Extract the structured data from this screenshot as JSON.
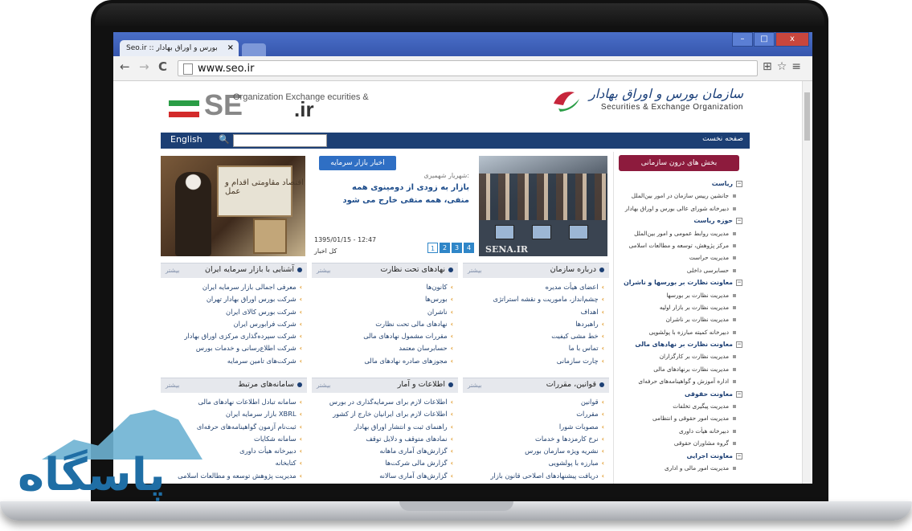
{
  "browser": {
    "tab_title": "Seo.ir :: بورس و اوراق بهادار",
    "tab_close": "×",
    "url": "www.seo.ir",
    "nav_back": "←",
    "nav_forward": "→",
    "nav_reload": "C",
    "toolbar_icons": "⊞☆≡",
    "win_min": "–",
    "win_max": "□",
    "win_close": "x"
  },
  "site": {
    "seo_logo": {
      "letters": "SE",
      "small": "Organization Exchange ecurities &",
      "ir": ".ir"
    },
    "org_logo": {
      "fa": "سازمان بورس و اوراق بهادار",
      "en_html": "Securities & Exchange Organization"
    },
    "nav": {
      "english": "English",
      "search_icon": "🔍",
      "home": "صفحه نخست"
    },
    "slide_left": {
      "calligraphy": "اقتصاد مقاومتی اقدام و عمل"
    },
    "news": {
      "button": "اخبار بازار سرمایه",
      "source": "شهریار شهمیری:",
      "title": "بازار به زودی از دومینوی همه منفی، همه منفی خارج می شود",
      "date": "1395/01/15 - 12:47",
      "all_news": "کل اخبار",
      "pages": [
        "1",
        "2",
        "3",
        "4"
      ]
    },
    "slide_right": {
      "watermark": "SENA.IR"
    },
    "sidebar": {
      "header": "بخش های درون سازمانی",
      "items": [
        {
          "t": "ریاست",
          "k": "h"
        },
        {
          "t": "جانشین رییس سازمان در امور بین‌الملل",
          "k": "s"
        },
        {
          "t": "دبیرخانه شورای عالی بورس و اوراق بهادار",
          "k": "s"
        },
        {
          "t": "حوزه ریاست",
          "k": "h"
        },
        {
          "t": "مدیریت روابط عمومی و امور بین‌الملل",
          "k": "s"
        },
        {
          "t": "مرکز پژوهش، توسعه و مطالعات اسلامی",
          "k": "s"
        },
        {
          "t": "مدیریت حراست",
          "k": "s"
        },
        {
          "t": "حسابرسی داخلی",
          "k": "s"
        },
        {
          "t": "معاونت نظارت بر بورسها و ناشران",
          "k": "h"
        },
        {
          "t": "مدیریت نظارت بر بورسها",
          "k": "s"
        },
        {
          "t": "مدیریت نظارت بر بازار اولیه",
          "k": "s"
        },
        {
          "t": "مدیریت نظارت بر ناشران",
          "k": "s"
        },
        {
          "t": "دبیرخانه کمیته مبارزه با پولشویی",
          "k": "s"
        },
        {
          "t": "معاونت نظارت بر نهادهای مالی",
          "k": "h"
        },
        {
          "t": "مدیریت نظارت بر کارگزاران",
          "k": "s"
        },
        {
          "t": "مدیریت نظارت برنهادهای مالی",
          "k": "s"
        },
        {
          "t": "اداره آموزش و گواهینامه‌های حرفه‌ای",
          "k": "s"
        },
        {
          "t": "معاونت حقوقی",
          "k": "h"
        },
        {
          "t": "مدیریت پیگیری تخلفات",
          "k": "s"
        },
        {
          "t": "مدیریت امور حقوقی و انتظامی",
          "k": "s"
        },
        {
          "t": "دبیرخانه هیأت داوری",
          "k": "s"
        },
        {
          "t": "گروه مشاوران حقوقی",
          "k": "s"
        },
        {
          "t": "معاونت اجرایی",
          "k": "h"
        },
        {
          "t": "مدیریت امور مالی و اداری",
          "k": "s"
        }
      ]
    },
    "boxes": [
      {
        "title": "درباره سازمان",
        "more": "بیشتر",
        "items": [
          "اعضای هیأت مدیره",
          "چشم‌انداز، ماموریت و نقشه استراتژی",
          "اهداف",
          "راهبردها",
          "خط مشی کیفیت",
          "تماس با ما",
          "چارت سازمانی"
        ]
      },
      {
        "title": "نهادهای تحت نظارت",
        "more": "بیشتر",
        "items": [
          "کانون‌ها",
          "بورس‌ها",
          "ناشران",
          "نهادهای مالی تحت نظارت",
          "مقررات مشمول نهادهای مالی",
          "حسابرسان معتمد",
          "مجوزهای صادره نهادهای مالی"
        ]
      },
      {
        "title": "آشنایی با بازار سرمایه ایران",
        "more": "بیشتر",
        "items": [
          "معرفی اجمالی بازار سرمایه ایران",
          "شرکت بورس اوراق بهادار تهران",
          "شرکت بورس کالای ایران",
          "شرکت فرابورس ایران",
          "شرکت سپرده‌گذاری مرکزی اوراق بهادار",
          "شرکت اطلاع‌رسانی و خدمات بورس",
          "شرکت‌های تامین سرمایه"
        ]
      },
      {
        "title": "قوانین، مقررات",
        "more": "بیشتر",
        "items": [
          "قوانین",
          "مقررات",
          "مصوبات شورا",
          "نرخ کارمزدها و خدمات",
          "نشریه ویژه سازمان بورس",
          "مبارزه با پولشویی",
          "دریافت پیشنهادهای اصلاحی قانون بازار"
        ]
      },
      {
        "title": "اطلاعات و آمار",
        "more": "بیشتر",
        "items": [
          "اطلاعات لازم برای سرمایه‌گذاری در بورس",
          "اطلاعات لازم برای ایرانیان خارج از کشور",
          "راهنمای ثبت و انتشار اوراق بهادار",
          "نمادهای متوقف و دلایل توقف",
          "گزارش‌های آماری ماهانه",
          "گزارش مالی شرکت‌ها",
          "گزارش‌های آماری سالانه"
        ]
      },
      {
        "title": "سامانه‌های مرتبط",
        "more": "بیشتر",
        "items": [
          "سامانه تبادل اطلاعات نهادهای مالی",
          "XBRL بازار سرمایه ایران",
          "ثبت‌نام آزمون گواهینامه‌های حرفه‌ای",
          "سامانه شکایات",
          "دبیرخانه هیأت داوری",
          "کتابخانه",
          "مدیریت پژوهش توسعه و مطالعات اسلامی"
        ]
      }
    ]
  },
  "watermark": {
    "text": "پاسگاه"
  }
}
